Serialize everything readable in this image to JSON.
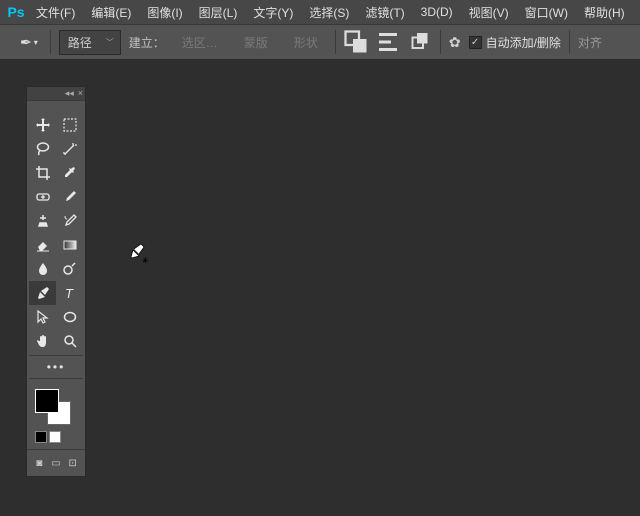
{
  "menubar": {
    "items": [
      {
        "label": "文件(F)"
      },
      {
        "label": "编辑(E)"
      },
      {
        "label": "图像(I)"
      },
      {
        "label": "图层(L)"
      },
      {
        "label": "文字(Y)"
      },
      {
        "label": "选择(S)"
      },
      {
        "label": "滤镜(T)"
      },
      {
        "label": "3D(D)"
      },
      {
        "label": "视图(V)"
      },
      {
        "label": "窗口(W)"
      },
      {
        "label": "帮助(H)"
      }
    ]
  },
  "optionsbar": {
    "mode_dropdown": "路径",
    "make_label": "建立：",
    "selection_btn": "选区…",
    "mask_btn": "蒙版",
    "shape_btn": "形状",
    "auto_add_delete_label": "自动添加/删除",
    "align_btn": "对齐"
  },
  "toolpanel": {
    "title": ""
  }
}
